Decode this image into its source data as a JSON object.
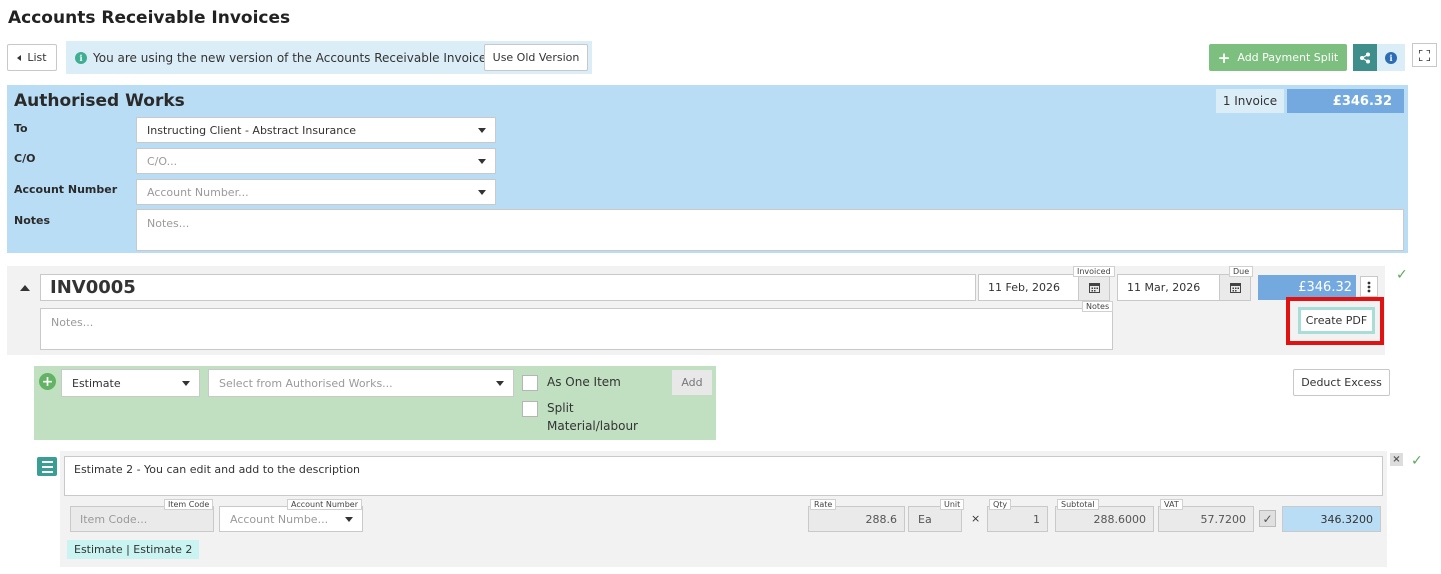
{
  "page": {
    "title": "Accounts Receivable Invoices"
  },
  "toolbar": {
    "list_label": "List",
    "info_message": "You are using the new version of the Accounts Receivable Invoices",
    "old_version_label": "Use Old Version",
    "add_payment_split_label": "Add Payment Split"
  },
  "authorised": {
    "title": "Authorised Works",
    "invoice_count": "1 Invoice",
    "total": "£346.32",
    "to_label": "To",
    "to_value": "Instructing Client - Abstract Insurance",
    "co_label": "C/O",
    "co_placeholder": "C/O...",
    "account_label": "Account Number",
    "account_placeholder": "Account Number...",
    "notes_label": "Notes",
    "notes_placeholder": "Notes..."
  },
  "invoice": {
    "number": "INV0005",
    "invoiced_label": "Invoiced",
    "invoiced_date": "11 Feb, 2026",
    "due_label": "Due",
    "due_date": "11 Mar, 2026",
    "total": "£346.32",
    "notes_placeholder": "Notes...",
    "notes_label": "Notes",
    "create_pdf_label": "Create PDF"
  },
  "add_item": {
    "type_value": "Estimate",
    "source_placeholder": "Select from Authorised Works...",
    "as_one_item_label": "As One Item",
    "split_label_line1": "Split",
    "split_label_line2": "Material/labour",
    "add_label": "Add",
    "deduct_excess_label": "Deduct Excess"
  },
  "line_item": {
    "description": "Estimate 2 - You can edit and add to the description",
    "item_code_label": "Item Code",
    "item_code_placeholder": "Item Code...",
    "account_label": "Account Number",
    "account_placeholder": "Account Numbe...",
    "rate_label": "Rate",
    "rate": "288.6",
    "unit_label": "Unit",
    "unit": "Ea",
    "times": "×",
    "qty_label": "Qty",
    "qty": "1",
    "subtotal_label": "Subtotal",
    "subtotal": "288.6000",
    "vat_label": "VAT",
    "vat": "57.7200",
    "total": "346.3200",
    "tag": "Estimate | Estimate 2"
  },
  "colors": {
    "panel_blue": "#b9ddf4",
    "total_blue": "#74a9df",
    "green_panel": "#c0e0c1",
    "green_button": "#7cbf7e",
    "highlight_red": "#e01212"
  }
}
